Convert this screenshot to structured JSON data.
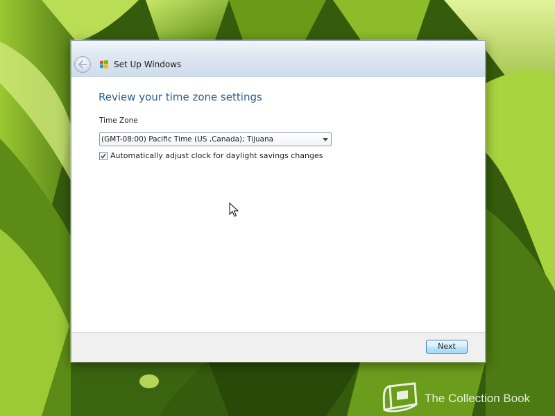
{
  "window": {
    "title": "Set Up Windows",
    "heading": "Review your time zone settings"
  },
  "time_zone": {
    "label": "Time Zone",
    "selected": "(GMT-08:00) Pacific Time (US ,Canada); Tijuana"
  },
  "dst": {
    "label": "Automatically adjust clock for daylight savings changes",
    "checked": true
  },
  "footer": {
    "next_label": "Next"
  },
  "watermark": {
    "text": "The Collection Book"
  },
  "icons": {
    "back": "back-arrow-icon",
    "logo": "windows-logo-icon",
    "dropdown": "chevron-down-icon",
    "check": "checkmark-icon",
    "cursor": "mouse-pointer-icon",
    "watermark": "book-icon"
  },
  "colors": {
    "heading": "#2a5d8f",
    "next_border": "#3c7fb1"
  }
}
